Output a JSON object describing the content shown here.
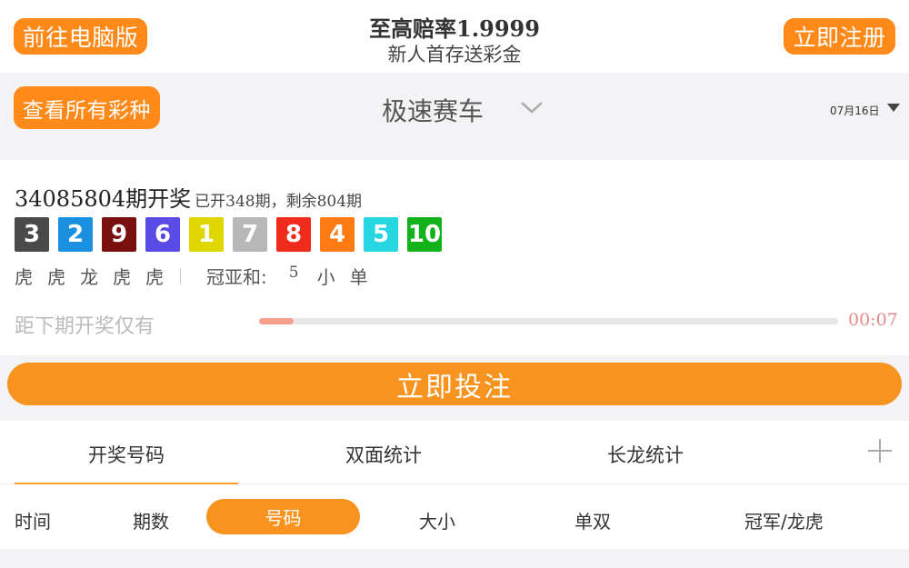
{
  "header": {
    "pc_button": "前往电脑版",
    "title": "至高赔率1.9999",
    "subtitle": "新人首存送彩金",
    "register_button": "立即注册"
  },
  "lottery_bar": {
    "all_button": "查看所有彩种",
    "lottery_name": "极速赛车",
    "chevron_icon": "chevron-down-icon",
    "date": "07月16日",
    "date_caret_icon": "caret-down-icon"
  },
  "draw": {
    "issue": "34085804期开奖",
    "issue_sub": "已开348期，剩余804期",
    "balls": [
      {
        "num": "3",
        "color": "#4a4a4a"
      },
      {
        "num": "2",
        "color": "#1b8fe0"
      },
      {
        "num": "9",
        "color": "#7a0f0f"
      },
      {
        "num": "6",
        "color": "#5a4be6"
      },
      {
        "num": "1",
        "color": "#e0d600"
      },
      {
        "num": "7",
        "color": "#b8b8b8"
      },
      {
        "num": "8",
        "color": "#f02b1c"
      },
      {
        "num": "4",
        "color": "#ff7a12"
      },
      {
        "num": "5",
        "color": "#26d6e0"
      },
      {
        "num": "10",
        "color": "#12b21a"
      }
    ],
    "dragon_tiger": [
      "虎",
      "虎",
      "龙",
      "虎",
      "虎"
    ],
    "sum_label": "冠亚和:",
    "sum_value": "5",
    "size": "小",
    "parity": "单",
    "countdown_label": "距下期开奖仅有",
    "countdown_progress": 0.06,
    "countdown_timer": "00:07"
  },
  "bet_button": "立即投注",
  "tabs": {
    "items": [
      "开奖号码",
      "双面统计",
      "长龙统计"
    ],
    "active_index": 0,
    "add_icon": "plus-icon"
  },
  "columns": {
    "time": "时间",
    "issue": "期数",
    "numbers": "号码",
    "size": "大小",
    "parity": "单双",
    "champion_dragon_tiger": "冠军/龙虎"
  },
  "colors": {
    "accent": "#f7931e",
    "progress_fill": "#f6a08c",
    "timer": "#e88a8a"
  }
}
